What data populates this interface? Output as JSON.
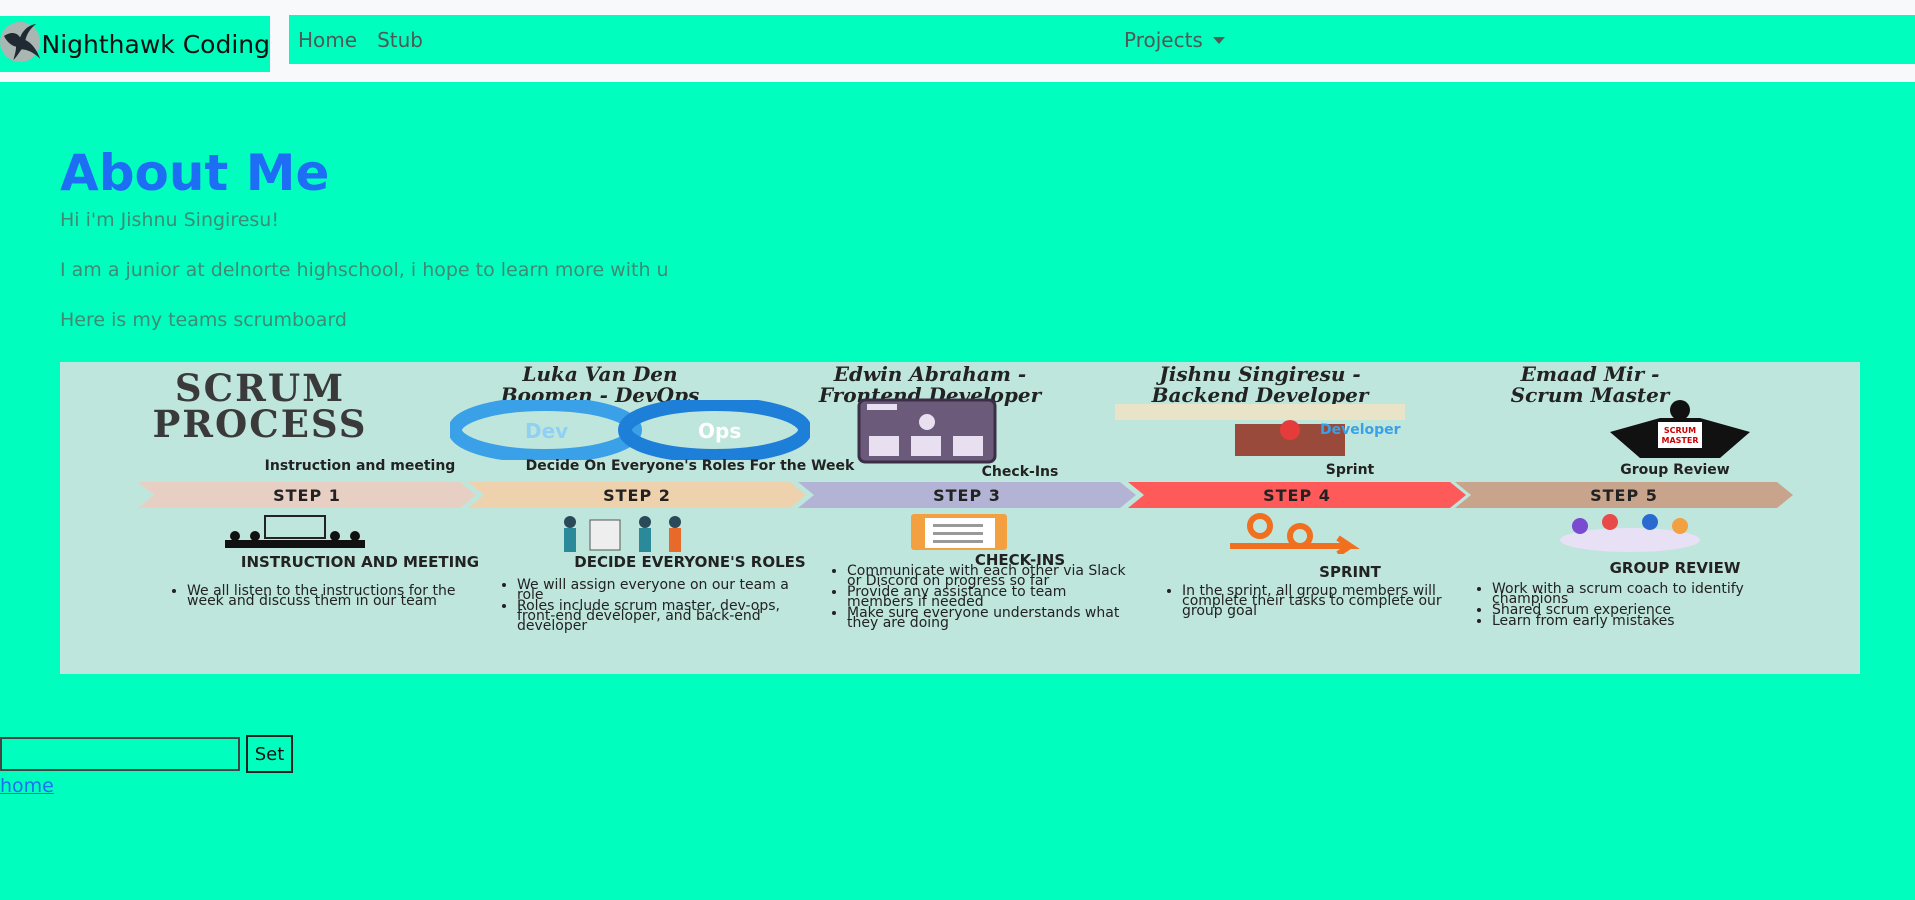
{
  "navbar": {
    "brand": "Nighthawk Coding",
    "links": [
      "Home",
      "Stub"
    ],
    "dropdown": "Projects"
  },
  "main": {
    "title": "About Me",
    "paragraphs": [
      "Hi i'm Jishnu Singiresu!",
      "I am a junior at delnorte highschool, i hope to learn more with u",
      "Here is my teams scrumboard"
    ]
  },
  "scrumboard": {
    "title_line1": "SCRUM",
    "title_line2": "PROCESS",
    "members": [
      {
        "name_line1": "Luka Van Den",
        "name_line2": "Boomen - DevOps"
      },
      {
        "name_line1": "Edwin Abraham -",
        "name_line2": "Frontend Developer"
      },
      {
        "name_line1": "Jishnu Singiresu -",
        "name_line2": "Backend Developer"
      },
      {
        "name_line1": "Emaad Mir -",
        "name_line2": "Scrum Master"
      }
    ],
    "steps": [
      {
        "top_label": "Instruction and meeting",
        "label": "STEP 1",
        "color": "#e8cfc3",
        "heading": "INSTRUCTION AND MEETING",
        "bullets": [
          "We all listen to the instructions for the week and discuss them in our team"
        ]
      },
      {
        "top_label": "Decide On Everyone's Roles For the Week",
        "label": "STEP 2",
        "color": "#eed1ad",
        "heading": "DECIDE EVERYONE'S ROLES",
        "bullets": [
          "We will assign everyone on our team a role",
          "Roles include scrum master, dev-ops, front-end developer, and back-end developer"
        ]
      },
      {
        "top_label": "Check-Ins",
        "label": "STEP 3",
        "color": "#b3b3d6",
        "heading": "CHECK-INS",
        "bullets": [
          "Communicate with each other via Slack or Discord on progress so far",
          "Provide any assistance to team members if needed",
          "Make sure everyone understands what they are doing"
        ]
      },
      {
        "top_label": "Sprint",
        "label": "STEP 4",
        "color": "#ff5a5a",
        "heading": "SPRINT",
        "bullets": [
          "In the sprint, all group members will complete their tasks to complete our group goal"
        ]
      },
      {
        "top_label": "Group Review",
        "label": "STEP 5",
        "color": "#c8a48c",
        "heading": "GROUP REVIEW",
        "bullets": [
          "Work with a scrum coach to identify champions",
          "Shared scrum experience",
          "Learn from early mistakes"
        ]
      }
    ],
    "devops_left": "Dev",
    "devops_right": "Ops",
    "backend_word": "Developer",
    "scrum_master_badge_line1": "SCRUM",
    "scrum_master_badge_line2": "MASTER"
  },
  "form": {
    "input_value": "",
    "button_label": "Set"
  },
  "footer": {
    "home_link": "home"
  }
}
